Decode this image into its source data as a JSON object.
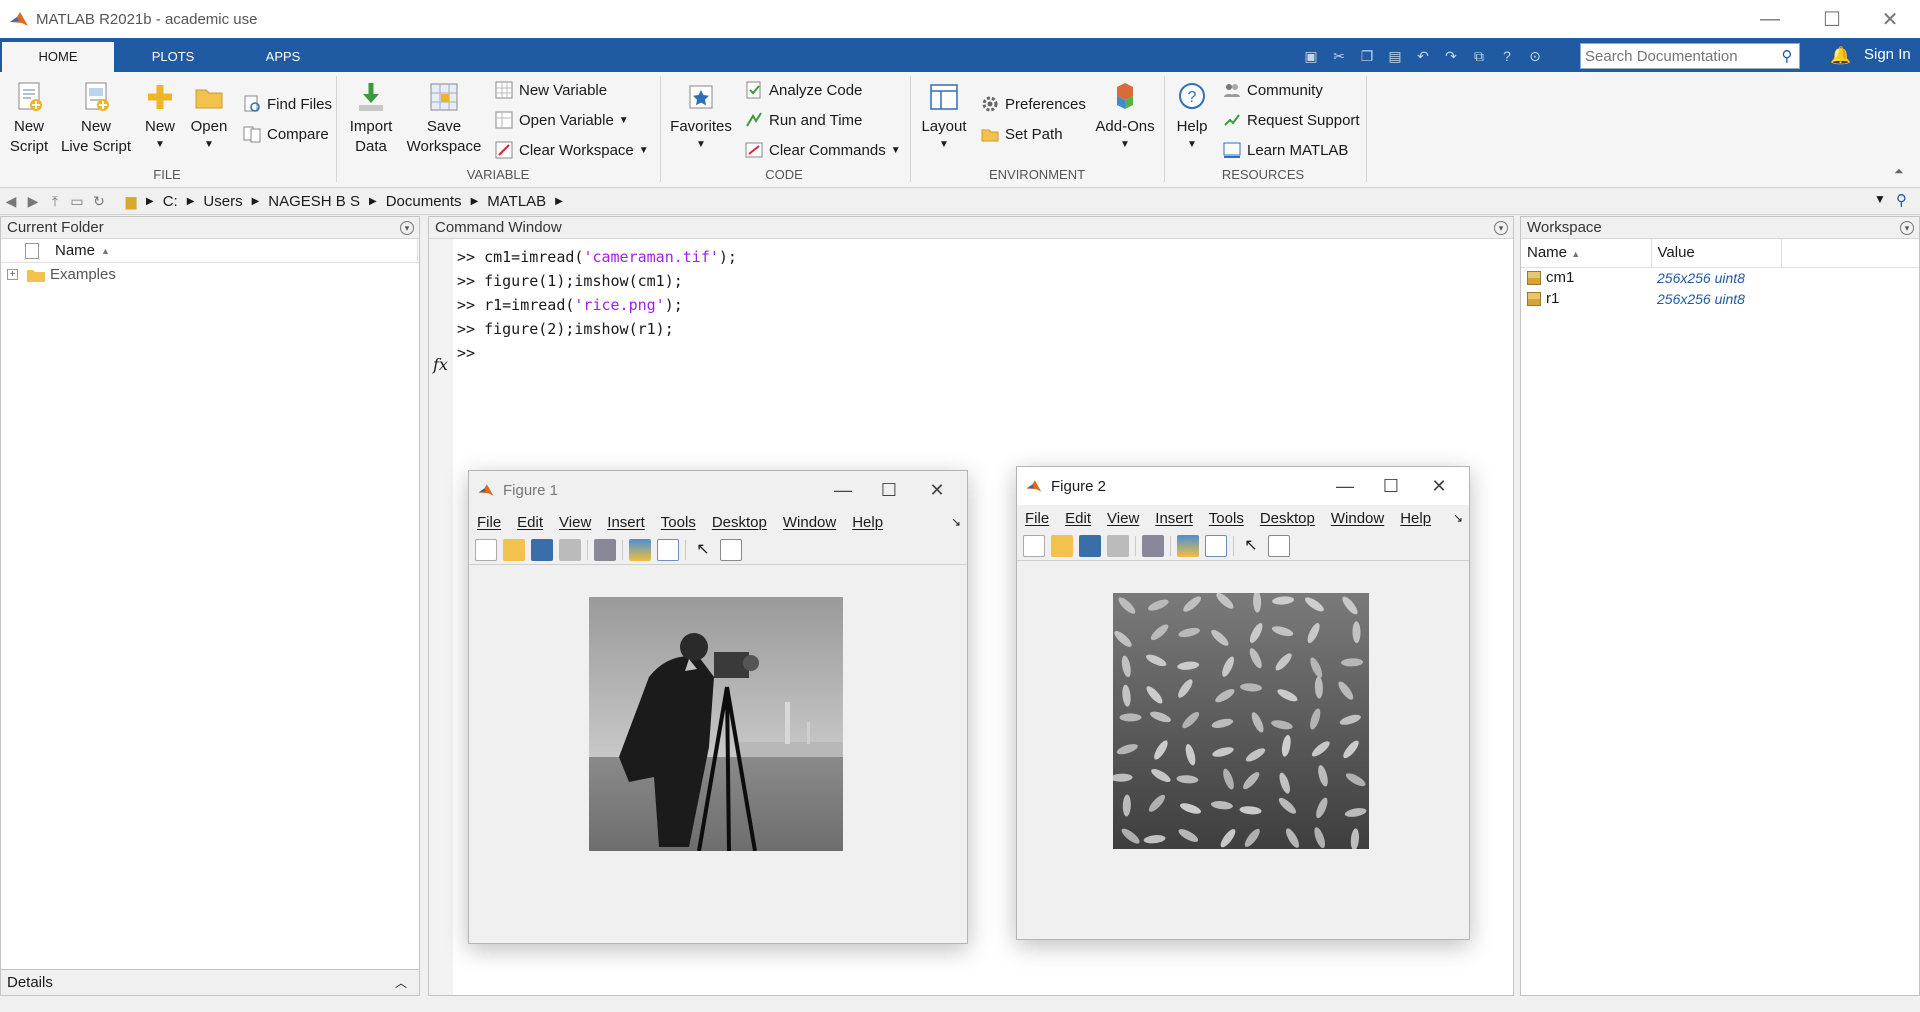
{
  "window": {
    "title": "MATLAB R2021b - academic use",
    "controls": {
      "minimize": "—",
      "maximize": "☐",
      "close": "✕"
    }
  },
  "tabs": [
    {
      "label": "HOME",
      "active": true
    },
    {
      "label": "PLOTS",
      "active": false
    },
    {
      "label": "APPS",
      "active": false
    }
  ],
  "search": {
    "placeholder": "Search Documentation"
  },
  "signin": "Sign In",
  "ribbon": {
    "file": {
      "label": "FILE",
      "new_script": "New\nScript",
      "new_live_script": "New\nLive Script",
      "new": "New",
      "open": "Open",
      "find_files": "Find Files",
      "compare": "Compare"
    },
    "variable": {
      "label": "VARIABLE",
      "import_data": "Import\nData",
      "save_workspace": "Save\nWorkspace",
      "new_variable": "New Variable",
      "open_variable": "Open Variable",
      "clear_workspace": "Clear Workspace"
    },
    "code": {
      "label": "CODE",
      "favorites": "Favorites",
      "analyze_code": "Analyze Code",
      "run_and_time": "Run and Time",
      "clear_commands": "Clear Commands"
    },
    "environment": {
      "label": "ENVIRONMENT",
      "layout": "Layout",
      "preferences": "Preferences",
      "set_path": "Set Path",
      "add_ons": "Add-Ons"
    },
    "resources": {
      "label": "RESOURCES",
      "help": "Help",
      "community": "Community",
      "request_support": "Request Support",
      "learn_matlab": "Learn MATLAB"
    }
  },
  "address": {
    "path": [
      "C:",
      "Users",
      "NAGESH B S",
      "Documents",
      "MATLAB"
    ]
  },
  "current_folder": {
    "title": "Current Folder",
    "column": "Name",
    "items": [
      {
        "name": "Examples",
        "type": "folder"
      }
    ],
    "details": "Details"
  },
  "command_window": {
    "title": "Command Window",
    "lines": [
      {
        "prompt": ">> ",
        "before": "cm1=imread(",
        "string": "'cameraman.tif'",
        "after": ");"
      },
      {
        "prompt": ">> ",
        "before": "figure(1);imshow(cm1);",
        "string": "",
        "after": ""
      },
      {
        "prompt": ">> ",
        "before": "r1=imread(",
        "string": "'rice.png'",
        "after": ");"
      },
      {
        "prompt": ">> ",
        "before": "figure(2);imshow(r1);",
        "string": "",
        "after": ""
      }
    ],
    "fx": "fx",
    "active_prompt": ">>"
  },
  "workspace": {
    "title": "Workspace",
    "columns": [
      "Name",
      "Value"
    ],
    "variables": [
      {
        "name": "cm1",
        "value": "256x256 uint8"
      },
      {
        "name": "r1",
        "value": "256x256 uint8"
      }
    ]
  },
  "figures": [
    {
      "title": "Figure 1",
      "menu": [
        "File",
        "Edit",
        "View",
        "Insert",
        "Tools",
        "Desktop",
        "Window",
        "Help"
      ],
      "image": "cameraman"
    },
    {
      "title": "Figure 2",
      "menu": [
        "File",
        "Edit",
        "View",
        "Insert",
        "Tools",
        "Desktop",
        "Window",
        "Help"
      ],
      "image": "rice"
    }
  ],
  "colors": {
    "tab_strip": "#1f5aa3",
    "string_literal": "#a020f0",
    "workspace_value": "#1f5aa3",
    "matlab_logo": "#e06a1a"
  }
}
